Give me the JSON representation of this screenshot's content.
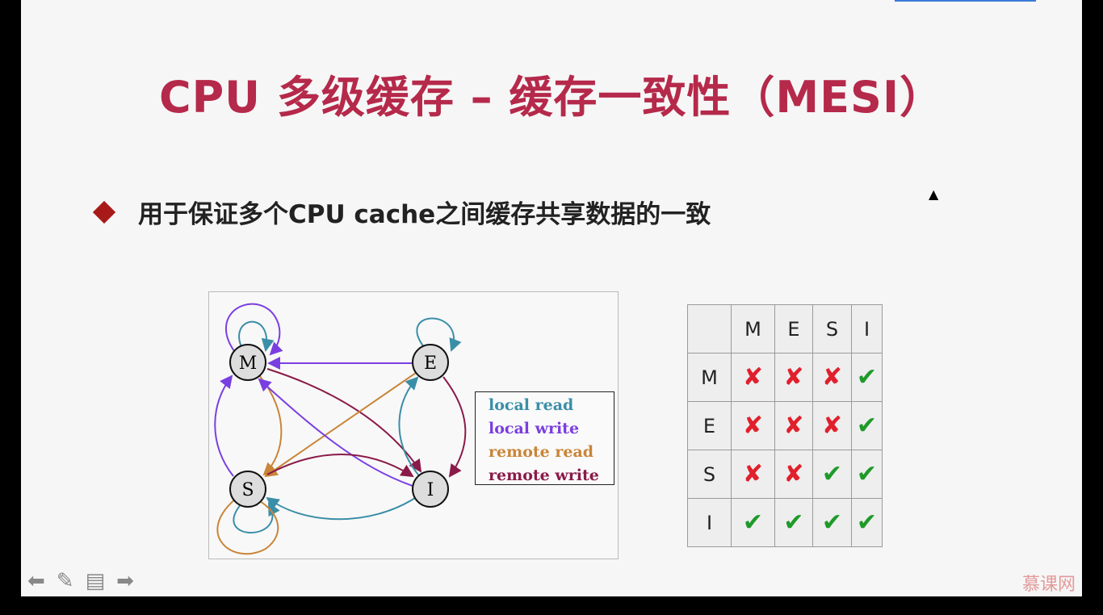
{
  "slide": {
    "title": "CPU 多级缓存 – 缓存一致性（MESI）",
    "bullet": "用于保证多个CPU cache之间缓存共享数据的一致",
    "diagram": {
      "states": [
        "M",
        "E",
        "S",
        "I"
      ],
      "legend": [
        {
          "label": "local read",
          "color": "#3a8ea8"
        },
        {
          "label": "local write",
          "color": "#7a3fe0"
        },
        {
          "label": "remote read",
          "color": "#c98538"
        },
        {
          "label": "remote write",
          "color": "#8a1a48"
        }
      ]
    },
    "table": {
      "headers": [
        "",
        "M",
        "E",
        "S",
        "I"
      ],
      "rows": [
        {
          "label": "M",
          "cells": [
            "✘",
            "✘",
            "✘",
            "✔"
          ]
        },
        {
          "label": "E",
          "cells": [
            "✘",
            "✘",
            "✘",
            "✔"
          ]
        },
        {
          "label": "S",
          "cells": [
            "✘",
            "✘",
            "✔",
            "✔"
          ]
        },
        {
          "label": "I",
          "cells": [
            "✔",
            "✔",
            "✔",
            "✔"
          ]
        }
      ]
    },
    "logo": "慕课网"
  },
  "controls": {
    "icons": [
      "arrow-left-icon",
      "pen-icon",
      "menu-icon",
      "arrow-right-icon"
    ]
  }
}
